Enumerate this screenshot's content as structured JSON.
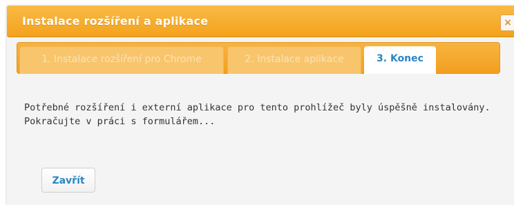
{
  "dialog": {
    "title": "Instalace rozšíření a aplikace",
    "close_icon": "×"
  },
  "tabs": [
    {
      "label": "1. Instalace rozšíření pro Chrome",
      "active": false
    },
    {
      "label": "2. Instalace aplikace",
      "active": false
    },
    {
      "label": "3. Konec",
      "active": true
    }
  ],
  "message": {
    "line1": "Potřebné rozšíření i externí aplikace pro tento prohlížeč byly úspěšně instalovány.",
    "line2": "Pokračujte v práci s formulářem..."
  },
  "actions": {
    "close_label": "Zavřít"
  },
  "colors": {
    "accent_orange": "#f4a21c",
    "link_blue": "#2a86c6"
  }
}
